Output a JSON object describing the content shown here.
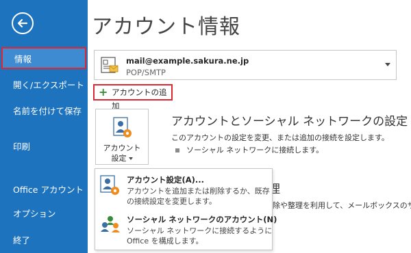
{
  "sidebar": {
    "items": [
      {
        "label": "情報",
        "selected": true
      },
      {
        "label": "開く/エクスポート"
      },
      {
        "label": "名前を付けて保存"
      },
      {
        "label": "印刷"
      },
      {
        "label": "Office アカウント"
      },
      {
        "label": "オプション"
      },
      {
        "label": "終了"
      }
    ]
  },
  "page": {
    "title": "アカウント情報"
  },
  "account": {
    "email": "mail@example.sakura.ne.jp",
    "type": "POP/SMTP"
  },
  "add_account": {
    "label": "アカウントの追加"
  },
  "settings_button": {
    "line1": "アカウント",
    "line2": "設定"
  },
  "section": {
    "heading": "アカウントとソーシャル ネットワークの設定",
    "description": "このアカウントの設定を変更、または追加の接続を設定します。",
    "bullet": "ソーシャル ネットワークに接続します。"
  },
  "background_fragments": {
    "heading": "理",
    "description": "除や整理を利用して、メールボックスのサイ"
  },
  "menu": {
    "items": [
      {
        "title": "アカウント設定(A)...",
        "desc1": "アカウントを追加または削除するか、既存",
        "desc2": "の接続設定を変更します。"
      },
      {
        "title": "ソーシャル ネットワークのアカウント(N)",
        "desc1": "ソーシャル ネットワークに接続するように",
        "desc2": "Office を構成します。"
      }
    ]
  },
  "colors": {
    "sidebar_bg": "#1e73be",
    "selected_bg": "#3e8bd1",
    "highlight_border": "#e0262e",
    "add_plus": "#3a8a3a"
  },
  "icons": [
    "back-arrow-icon",
    "account-card-icon",
    "plus-icon",
    "account-settings-icon",
    "social-network-icon",
    "dropdown-caret-icon"
  ]
}
